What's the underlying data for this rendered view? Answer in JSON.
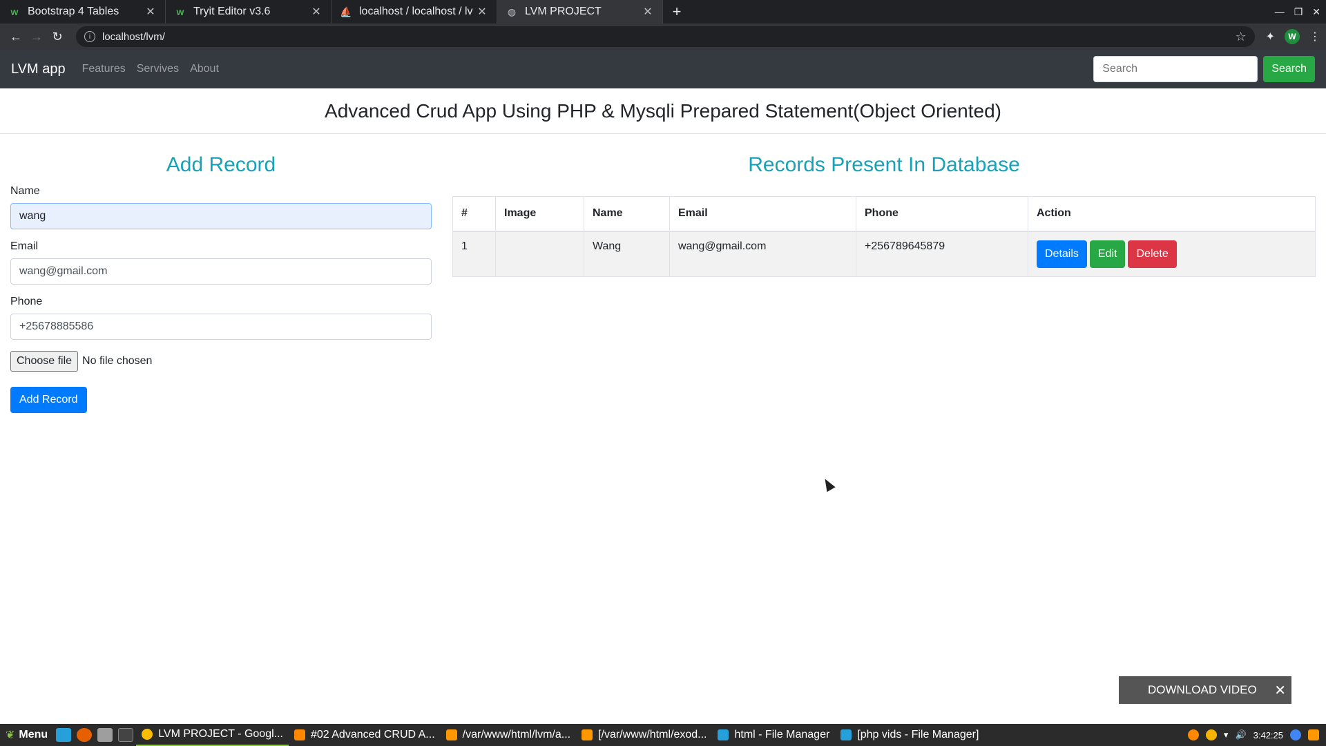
{
  "browser": {
    "tabs": [
      {
        "title": "Bootstrap 4 Tables",
        "icon": "w3schools-icon",
        "active": false
      },
      {
        "title": "Tryit Editor v3.6",
        "icon": "w3schools-icon",
        "active": false
      },
      {
        "title": "localhost / localhost / lv",
        "icon": "phpmyadmin-icon",
        "active": false
      },
      {
        "title": "LVM PROJECT",
        "icon": "globe-icon",
        "active": true
      }
    ],
    "url": "localhost/lvm/",
    "profile_initial": "W"
  },
  "navbar": {
    "brand": "LVM app",
    "links": [
      "Features",
      "Servives",
      "About"
    ],
    "search_placeholder": "Search",
    "search_button": "Search"
  },
  "page": {
    "title": "Advanced Crud App Using PHP & Mysqli Prepared Statement(Object Oriented)"
  },
  "form": {
    "heading": "Add Record",
    "name_label": "Name",
    "name_value": "wang",
    "email_label": "Email",
    "email_value": "wang@gmail.com",
    "phone_label": "Phone",
    "phone_value": "+25678885586",
    "file_button": "Choose file",
    "file_status": "No file chosen",
    "submit": "Add Record"
  },
  "records": {
    "heading": "Records Present In Database",
    "columns": [
      "#",
      "Image",
      "Name",
      "Email",
      "Phone",
      "Action"
    ],
    "rows": [
      {
        "id": "1",
        "image": "",
        "name": "Wang",
        "email": "wang@gmail.com",
        "phone": "+256789645879"
      }
    ],
    "actions": {
      "details": "Details",
      "edit": "Edit",
      "delete": "Delete"
    }
  },
  "popup": {
    "label": "DOWNLOAD VIDEO",
    "close": "✕"
  },
  "taskbar": {
    "menu_label": "Menu",
    "items": [
      {
        "label": "LVM PROJECT - Googl...",
        "active": true
      },
      {
        "label": "#02 Advanced CRUD A...",
        "active": false
      },
      {
        "label": "/var/www/html/lvm/a...",
        "active": false
      },
      {
        "label": "[/var/www/html/exod...",
        "active": false
      },
      {
        "label": "html - File Manager",
        "active": false
      },
      {
        "label": "[php vids - File Manager]",
        "active": false
      }
    ],
    "clock": "3:42:25"
  },
  "colors": {
    "navbar_bg": "#343a40",
    "accent_teal": "#17a2b8",
    "primary": "#007bff",
    "success": "#28a745",
    "danger": "#dc3545"
  }
}
